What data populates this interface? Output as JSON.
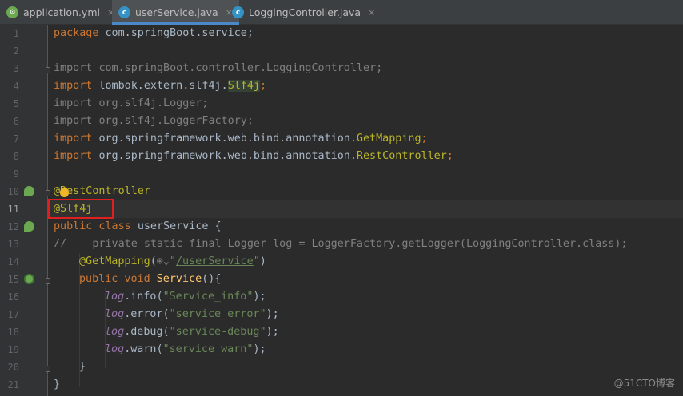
{
  "tabs": [
    {
      "label": "application.yml",
      "close": "×"
    },
    {
      "label": "userService.java",
      "close": "×"
    },
    {
      "label": "LoggingController.java",
      "close": "×"
    }
  ],
  "line_numbers": [
    "1",
    "2",
    "3",
    "4",
    "5",
    "6",
    "7",
    "8",
    "9",
    "10",
    "11",
    "12",
    "13",
    "14",
    "15",
    "16",
    "17",
    "18",
    "19",
    "20",
    "21"
  ],
  "code": {
    "l1_kw": "package ",
    "l1_rest": "com.springBoot.service;",
    "l3_kw": "import ",
    "l3_rest": "com.springBoot.controller.LoggingController;",
    "l4_kw": "import ",
    "l4_pkg": "lombok.extern.slf4j.",
    "l4_ann": "Slf4j",
    "l4_end": ";",
    "l5_kw": "import ",
    "l5_rest": "org.slf4j.Logger;",
    "l6_kw": "import ",
    "l6_rest": "org.slf4j.LoggerFactory;",
    "l7_kw": "import ",
    "l7_pkg": "org.springframework.web.bind.annotation.",
    "l7_ann": "GetMapping",
    "l7_end": ";",
    "l8_kw": "import ",
    "l8_pkg": "org.springframework.web.bind.annotation.",
    "l8_ann": "RestController",
    "l8_end": ";",
    "l10": "@RestController",
    "l11": "@Slf4j",
    "l12_kw": "public class ",
    "l12_rest": "userService {",
    "l13": "//    private static final Logger log = LoggerFactory.getLogger(LoggingController.class);",
    "l14_ann": "@GetMapping",
    "l14_paren": "(",
    "l14_icon": "⊛⌄",
    "l14_q1": "\"",
    "l14_str": "/userService",
    "l14_q2": "\"",
    "l14_end": ")",
    "l15_kw": "public void ",
    "l15_m": "Service",
    "l15_rest": "(){",
    "l16_log": "log",
    "l16_call": ".info(",
    "l16_str": "\"Service_info\"",
    "l16_end": ");",
    "l17_log": "log",
    "l17_call": ".error(",
    "l17_str": "\"service_error\"",
    "l17_end": ");",
    "l18_log": "log",
    "l18_call": ".debug(",
    "l18_str": "\"service-debug\"",
    "l18_end": ");",
    "l19_log": "log",
    "l19_call": ".warn(",
    "l19_str": "\"service_warn\"",
    "l19_end": ");",
    "l20": "}",
    "l21": "}"
  },
  "watermark": "@51CTO博客",
  "colors": {
    "keyword": "#cc7832",
    "annotation": "#bbb529",
    "string": "#6a8759",
    "comment": "#808080",
    "field": "#9876aa",
    "method": "#ffc66d",
    "highlight_box": "#e02020"
  }
}
